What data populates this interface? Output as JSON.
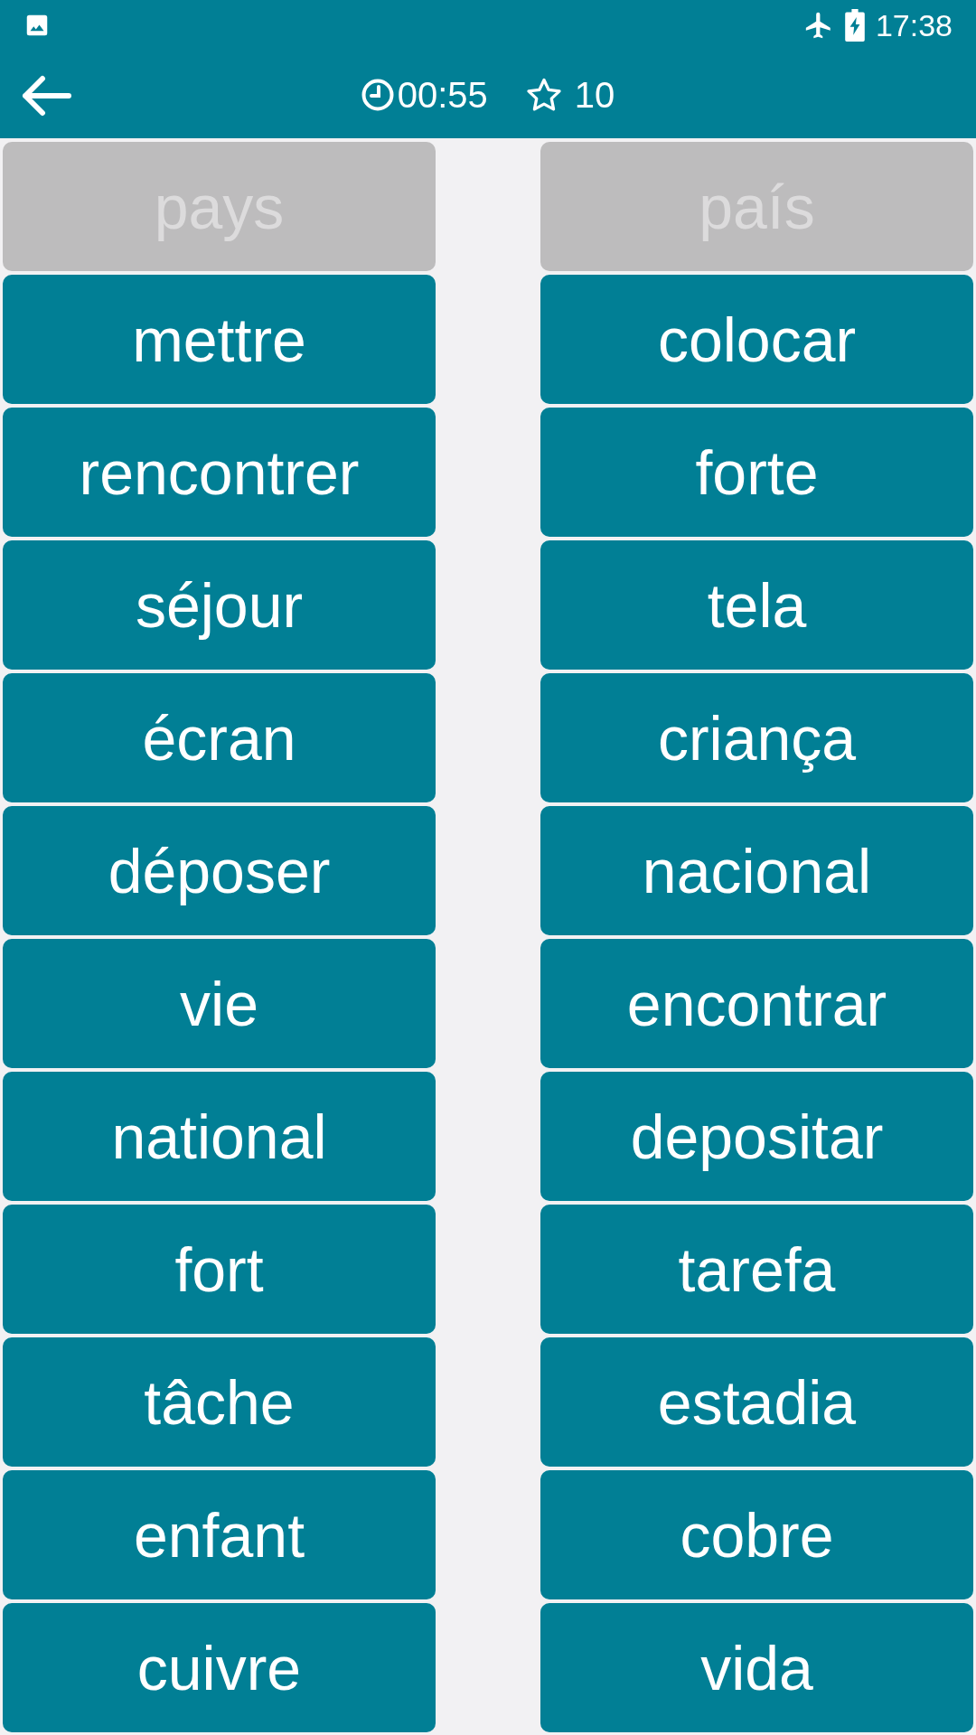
{
  "status_bar": {
    "time": "17:38"
  },
  "toolbar": {
    "timer": "00:55",
    "score": "10"
  },
  "left_column": [
    {
      "text": "pays",
      "disabled": true
    },
    {
      "text": "mettre",
      "disabled": false
    },
    {
      "text": "rencontrer",
      "disabled": false
    },
    {
      "text": "séjour",
      "disabled": false
    },
    {
      "text": "écran",
      "disabled": false
    },
    {
      "text": "déposer",
      "disabled": false
    },
    {
      "text": "vie",
      "disabled": false
    },
    {
      "text": "national",
      "disabled": false
    },
    {
      "text": "fort",
      "disabled": false
    },
    {
      "text": "tâche",
      "disabled": false
    },
    {
      "text": "enfant",
      "disabled": false
    },
    {
      "text": "cuivre",
      "disabled": false
    }
  ],
  "right_column": [
    {
      "text": "país",
      "disabled": true
    },
    {
      "text": "colocar",
      "disabled": false
    },
    {
      "text": "forte",
      "disabled": false
    },
    {
      "text": "tela",
      "disabled": false
    },
    {
      "text": "criança",
      "disabled": false
    },
    {
      "text": "nacional",
      "disabled": false
    },
    {
      "text": "encontrar",
      "disabled": false
    },
    {
      "text": "depositar",
      "disabled": false
    },
    {
      "text": "tarefa",
      "disabled": false
    },
    {
      "text": "estadia",
      "disabled": false
    },
    {
      "text": "cobre",
      "disabled": false
    },
    {
      "text": "vida",
      "disabled": false
    }
  ]
}
